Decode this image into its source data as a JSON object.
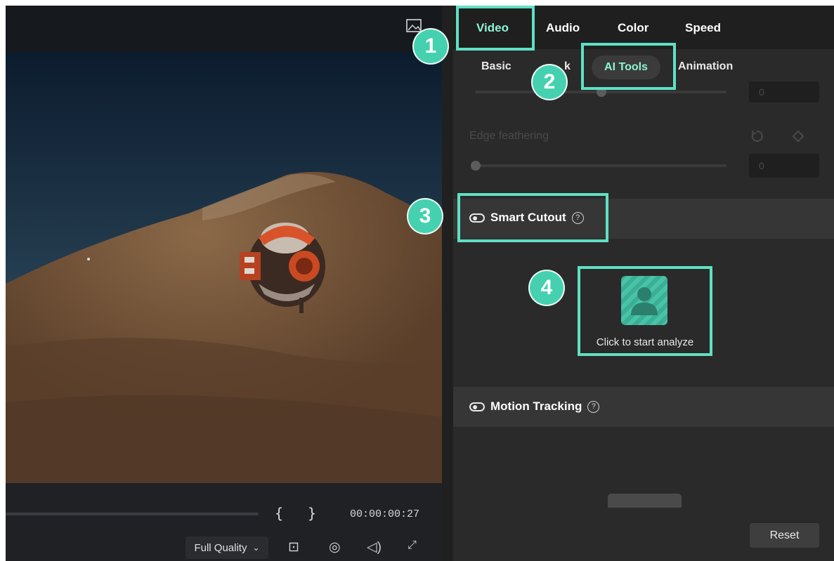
{
  "player": {
    "timecode": "00:00:00:27",
    "mark_in": "{",
    "mark_out": "}",
    "quality": "Full Quality",
    "quality_chevron": "⌄",
    "controls": [
      {
        "icon": "display-icon",
        "glyph": "⊡"
      },
      {
        "icon": "snapshot-icon",
        "glyph": "◎"
      },
      {
        "icon": "volume-icon",
        "glyph": "◁)"
      },
      {
        "icon": "fullscreen-icon",
        "glyph": "⤢"
      }
    ]
  },
  "panel": {
    "tabs": [
      "Video",
      "Audio",
      "Color",
      "Speed"
    ],
    "active_tab": "Video",
    "subtabs": [
      "Basic",
      "k",
      "AI Tools",
      "Animation"
    ],
    "active_subtab": "AI Tools",
    "slider1_value": "0",
    "edge_feathering": {
      "label": "Edge feathering",
      "value": "0"
    },
    "smart_cutout": {
      "title": "Smart Cutout",
      "help": "?"
    },
    "analyze": {
      "label": "Click to start analyze"
    },
    "motion_tracking": {
      "title": "Motion Tracking",
      "help": "?"
    },
    "reset_label": "Reset"
  },
  "steps": [
    "1",
    "2",
    "3",
    "4"
  ],
  "colors": {
    "accent": "#8ef3d4",
    "highlight": "#5fe0c3",
    "badge": "#45d1b0",
    "panel": "#2a2a2a"
  }
}
